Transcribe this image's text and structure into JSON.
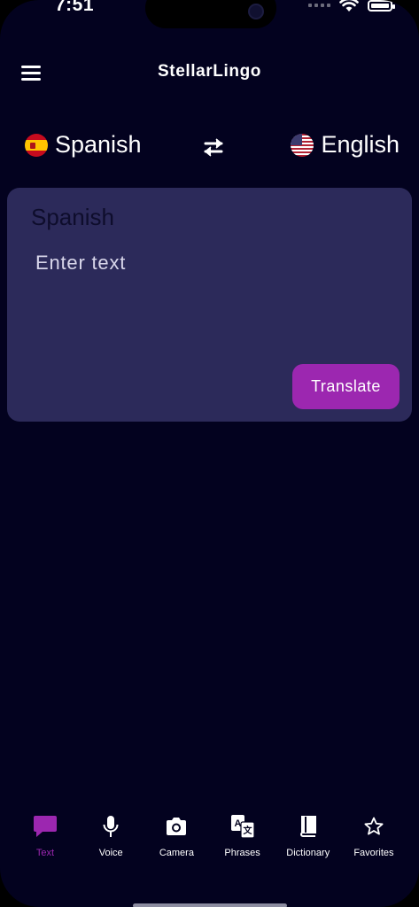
{
  "status_bar": {
    "time": "7:51"
  },
  "app": {
    "title": "StellarLingo"
  },
  "languages": {
    "source": {
      "label": "Spanish",
      "flag": "spain-flag-icon"
    },
    "target": {
      "label": "English",
      "flag": "us-flag-icon"
    }
  },
  "input_card": {
    "language_label": "Spanish",
    "placeholder": "Enter text",
    "value": "",
    "translate_label": "Translate"
  },
  "bottom_nav": {
    "active": "Text",
    "items": [
      {
        "label": "Text",
        "icon": "chat-bubble-icon"
      },
      {
        "label": "Voice",
        "icon": "microphone-icon"
      },
      {
        "label": "Camera",
        "icon": "camera-icon"
      },
      {
        "label": "Phrases",
        "icon": "translate-icon"
      },
      {
        "label": "Dictionary",
        "icon": "book-icon"
      },
      {
        "label": "Favorites",
        "icon": "star-icon"
      }
    ]
  },
  "colors": {
    "background": "#03021f",
    "card": "#2c2a5a",
    "accent": "#9c27b0",
    "text": "#ffffff"
  }
}
